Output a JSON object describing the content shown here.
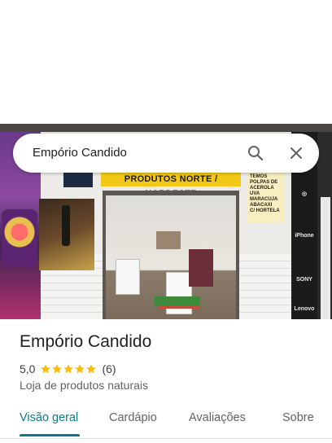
{
  "search": {
    "query": "Empório Candido",
    "search_icon": "search-icon",
    "close_icon": "close-icon"
  },
  "photo": {
    "sign_text": "PRODUTOS NORTE / NORDESTE",
    "menu_board_lines": [
      "TEMOS",
      "POLPAS DE",
      "ACEROLA",
      "UVA",
      "MARACUJA",
      "ABACAXI",
      "C/ HORTELA"
    ],
    "panel_labels": [
      "iPhone",
      "SONY",
      "Lenovo"
    ]
  },
  "place": {
    "name": "Empório Candido",
    "rating": "5,0",
    "stars": 5,
    "reviews_count": "(6)",
    "category": "Loja de produtos naturais"
  },
  "tabs": [
    {
      "label": "Visão geral",
      "active": true
    },
    {
      "label": "Cardápio",
      "active": false
    },
    {
      "label": "Avaliações",
      "active": false
    },
    {
      "label": "Sobre",
      "active": false
    }
  ],
  "colors": {
    "accent": "#0b7a86",
    "star": "#fbbc04",
    "title": "#202124",
    "secondary": "#5f6368"
  }
}
